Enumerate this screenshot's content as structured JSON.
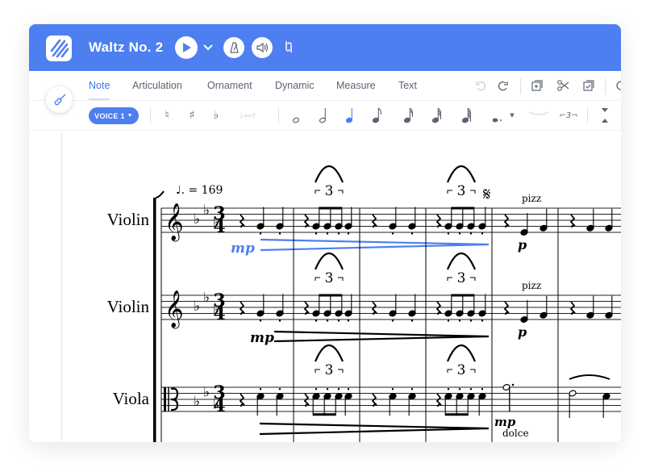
{
  "header": {
    "title": "Waltz No. 2",
    "icons": [
      "logo-icon",
      "play-icon",
      "chevron-down-icon",
      "metronome-icon",
      "speaker-icon",
      "tuner-icon"
    ]
  },
  "tabs": [
    {
      "label": "Note",
      "active": true
    },
    {
      "label": "Articulation"
    },
    {
      "label": "Ornament"
    },
    {
      "label": "Dynamic"
    },
    {
      "label": "Measure"
    },
    {
      "label": "Text"
    }
  ],
  "edit_icons": [
    "undo-icon",
    "redo-icon",
    "add-staff-icon",
    "scissors-icon",
    "copy-icon",
    "more-icon"
  ],
  "toolbar": {
    "voice": "VOICE 1",
    "accidentals": [
      "♮",
      "♯",
      "♭",
      "♭↔♯"
    ],
    "durations": [
      "whole",
      "half",
      "quarter",
      "eighth",
      "16th",
      "32nd",
      "64th"
    ],
    "selected_duration": "quarter",
    "tuplet": "⌐3¬"
  },
  "accent": "#4d7ff0",
  "score": {
    "tempo": "♩. = 169",
    "time_signature": [
      "3",
      "4"
    ],
    "key": "3 flats",
    "staves": [
      {
        "name": "Violin",
        "clef": "treble",
        "dynamic": "mp",
        "dynamic_selected": true,
        "pizz": "pizz",
        "dynamic2": "p"
      },
      {
        "name": "Violin",
        "clef": "treble",
        "dynamic": "mp",
        "pizz": "pizz",
        "dynamic2": "p"
      },
      {
        "name": "Viola",
        "clef": "alto",
        "dynamic": "mp",
        "expression": "dolce"
      }
    ],
    "tuplet_number": "3",
    "segno": "𝄋"
  }
}
